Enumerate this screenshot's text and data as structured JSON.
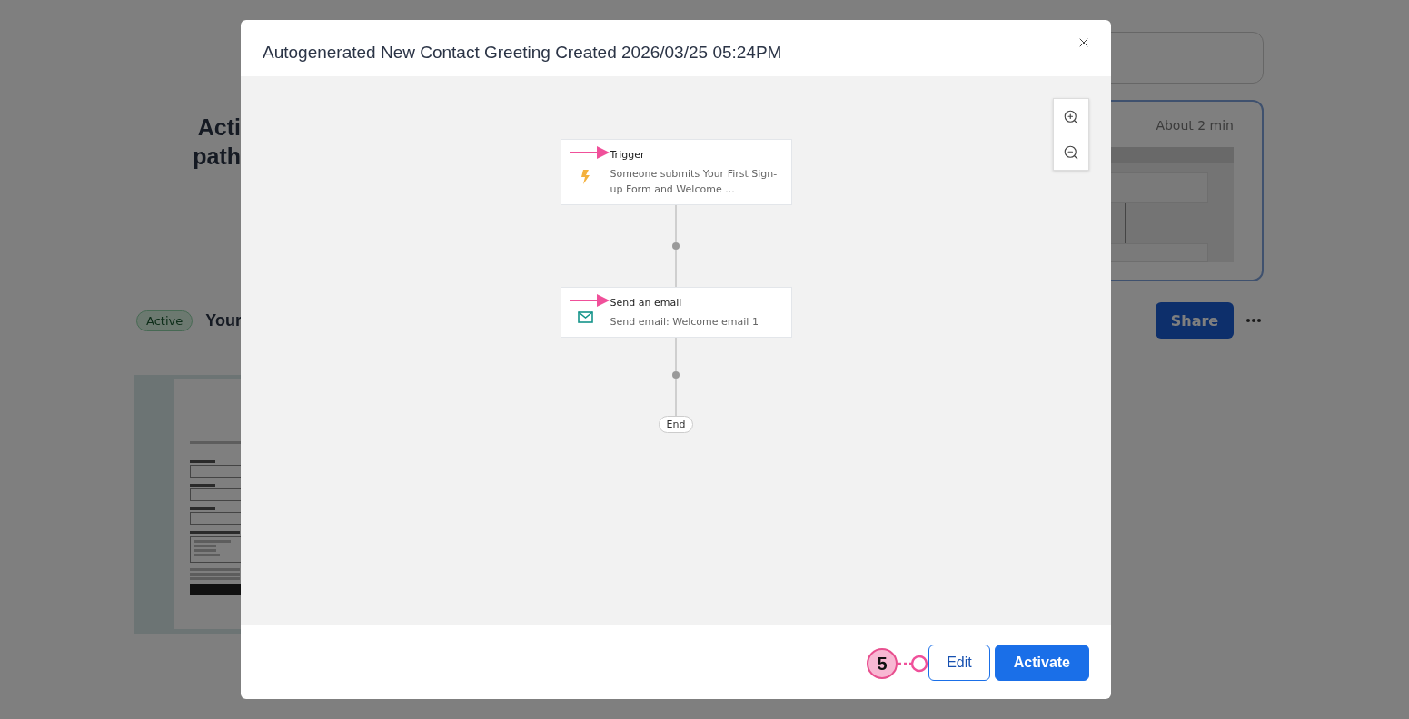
{
  "background": {
    "heading_lines": [
      "Acti",
      "path"
    ],
    "preview_card": {
      "duration": "About 2 min"
    },
    "item": {
      "status": "Active",
      "title": "Your",
      "share": "Share"
    }
  },
  "modal": {
    "title": "Autogenerated New Contact Greeting Created 2026/03/25 05:24PM",
    "nodes": [
      {
        "kind": "trigger",
        "title": "Trigger",
        "description": "Someone submits Your First Sign-up Form and Welcome ..."
      },
      {
        "kind": "email",
        "title": "Send an email",
        "description": "Send email: Welcome email 1"
      }
    ],
    "end_label": "End",
    "buttons": [
      {
        "kind": "secondary",
        "label": "Edit"
      },
      {
        "kind": "primary",
        "label": "Activate"
      }
    ],
    "annotation": {
      "step": "5"
    }
  }
}
